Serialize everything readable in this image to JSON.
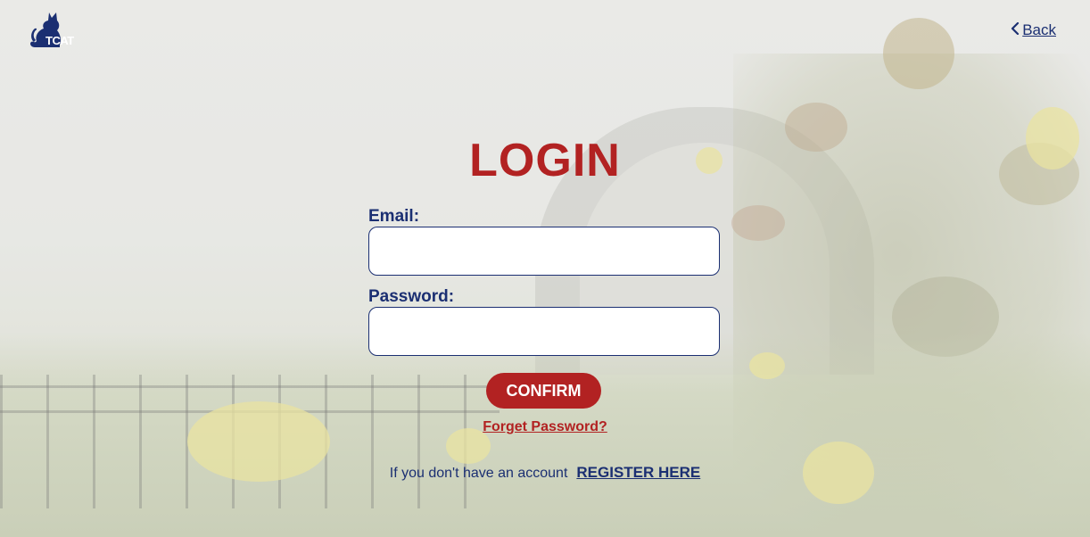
{
  "header": {
    "logo_text": "TCAT",
    "back_label": "Back"
  },
  "form": {
    "title": "LOGIN",
    "email_label": "Email:",
    "email_value": "",
    "password_label": "Password:",
    "password_value": "",
    "confirm_label": "CONFIRM",
    "forgot_label": "Forget Password?"
  },
  "footer": {
    "no_account_text": "If you don't have an account",
    "register_label": "REGISTER HERE"
  },
  "colors": {
    "primary_navy": "#1b2f72",
    "accent_red": "#b22222",
    "input_bg": "#ffffff"
  },
  "icons": {
    "logo": "cat-logo-icon",
    "back": "chevron-left-icon"
  }
}
